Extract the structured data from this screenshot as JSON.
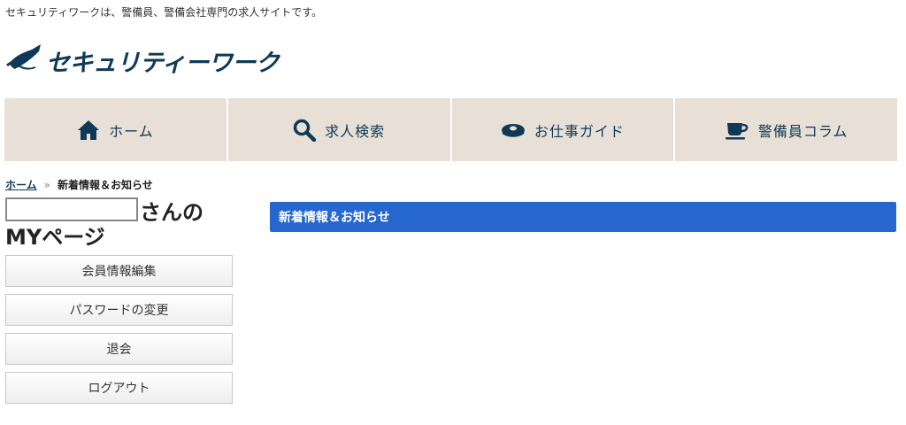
{
  "tagline": "セキュリティワークは、警備員、警備会社専門の求人サイトです。",
  "logo": {
    "text": "セキュリティーワーク",
    "icon": "guard-cap-icon"
  },
  "nav": [
    {
      "label": "ホーム",
      "icon": "home-icon"
    },
    {
      "label": "求人検索",
      "icon": "search-icon"
    },
    {
      "label": "お仕事ガイド",
      "icon": "cap-icon"
    },
    {
      "label": "警備員コラム",
      "icon": "coffee-cup-icon"
    }
  ],
  "breadcrumb": {
    "home": "ホーム",
    "separator": "»",
    "current": "新着情報＆お知らせ"
  },
  "mypage": {
    "name_value": "",
    "suffix": "さんの",
    "title": "MYページ"
  },
  "menu": [
    {
      "label": "会員情報編集"
    },
    {
      "label": "パスワードの変更"
    },
    {
      "label": "退会"
    },
    {
      "label": "ログアウト"
    }
  ],
  "news": {
    "header": "新着情報＆お知らせ"
  },
  "colors": {
    "brand_navy": "#0e3957",
    "nav_bg": "#e8e0d6",
    "accent_blue": "#2567cf"
  }
}
